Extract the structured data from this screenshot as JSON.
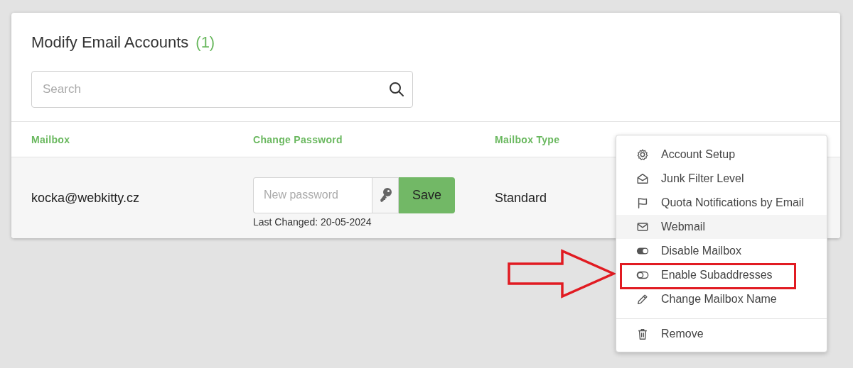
{
  "panel": {
    "title": "Modify Email Accounts",
    "count": "(1)"
  },
  "search": {
    "placeholder": "Search"
  },
  "table": {
    "columns": [
      "Mailbox",
      "Change Password",
      "Mailbox Type"
    ],
    "rows": [
      {
        "mailbox": "kocka@webkitty.cz",
        "password_placeholder": "New password",
        "save": "Save",
        "last_changed": "Last Changed: 20-05-2024",
        "type": "Standard"
      }
    ]
  },
  "menu": {
    "items": [
      {
        "label": "Account Setup",
        "hovered": false,
        "highlighted": false
      },
      {
        "label": "Junk Filter Level",
        "hovered": false,
        "highlighted": false
      },
      {
        "label": "Quota Notifications by Email",
        "hovered": false,
        "highlighted": false
      },
      {
        "label": "Webmail",
        "hovered": true,
        "highlighted": false
      },
      {
        "label": "Disable Mailbox",
        "hovered": false,
        "highlighted": false
      },
      {
        "label": "Enable Subaddresses",
        "hovered": false,
        "highlighted": true
      },
      {
        "label": "Change Mailbox Name",
        "hovered": false,
        "highlighted": false
      }
    ],
    "footer_items": [
      {
        "label": "Remove",
        "hovered": false,
        "highlighted": false
      }
    ]
  }
}
